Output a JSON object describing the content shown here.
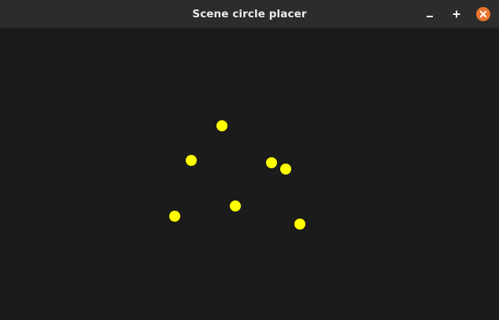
{
  "window": {
    "title": "Scene circle placer",
    "accent_close_color": "#e8742f"
  },
  "controls": {
    "minimize_icon": "minimize-icon",
    "maximize_icon": "maximize-icon",
    "close_icon": "close-icon"
  },
  "scene": {
    "background_color": "#1b1b1b",
    "circle_color": "#ffff00",
    "circle_count": 7
  }
}
